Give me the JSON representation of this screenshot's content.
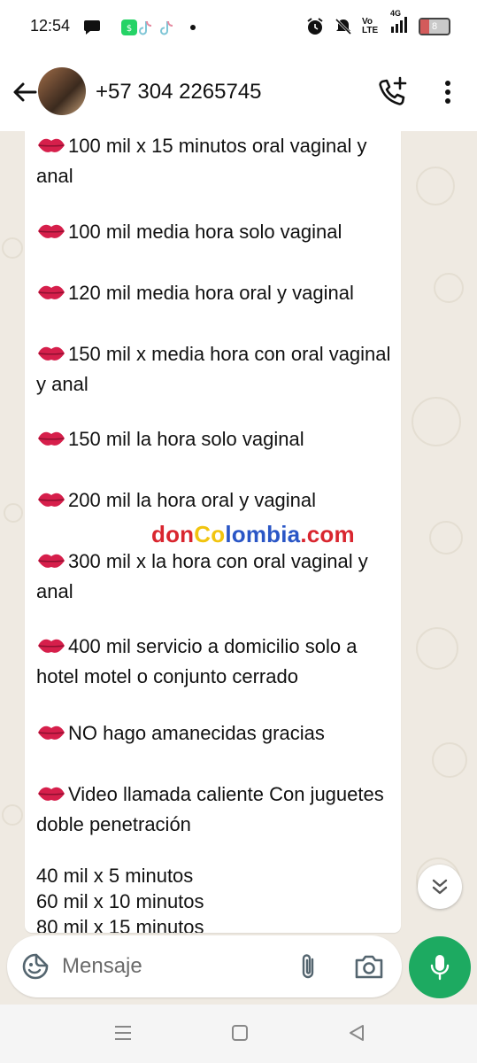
{
  "status_bar": {
    "time": "12:54",
    "battery_level": "8",
    "network": "4G",
    "volte": "Vo LTE",
    "left_icons": [
      "chat-bubble-icon",
      "whatsapp-icon",
      "tiktok-icon",
      "tiktok-icon",
      "dot-icon"
    ],
    "right_icons": [
      "alarm-icon",
      "mute-icon",
      "volte-icon",
      "signal-icon",
      "battery-icon"
    ]
  },
  "header": {
    "contact_name": "+57 304 2265745",
    "actions": [
      "back-arrow-icon",
      "add-call-icon",
      "more-vertical-icon"
    ]
  },
  "message": {
    "lines": [
      {
        "text": "100  mil x 15 minutos oral vaginal y anal",
        "icon": "kiss-lips-icon"
      },
      {
        "text": "100 mil media hora solo vaginal",
        "icon": "kiss-lips-icon"
      },
      {
        "text": "120 mil media hora  oral y vaginal",
        "icon": "kiss-lips-icon"
      },
      {
        "text": "150 mil x media hora con oral vaginal y anal",
        "icon": "kiss-lips-icon"
      },
      {
        "text": "150 mil  la hora solo vaginal",
        "icon": "kiss-lips-icon"
      },
      {
        "text": "200 mil la hora oral y vaginal",
        "icon": "kiss-lips-icon"
      },
      {
        "text": "300 mil x la hora con oral vaginal y anal",
        "icon": "kiss-lips-icon"
      },
      {
        "text": "400 mil servicio a domicilio solo a hotel motel o conjunto cerrado",
        "icon": "kiss-lips-icon"
      },
      {
        "text": "NO hago amanecidas gracias",
        "icon": "kiss-lips-icon"
      },
      {
        "text": "Video llamada caliente Con juguetes doble penetración",
        "icon": "kiss-lips-icon"
      }
    ],
    "plain_lines": [
      "40 mil x 5 minutos",
      "60 mil x 10 minutos",
      "80 mil x 15 minutos"
    ]
  },
  "watermark": {
    "part1": "don",
    "part2": "Co",
    "part3": "lombia",
    "part4": ".com",
    "colors": {
      "red": "#d9262f",
      "yellow": "#f1c40f",
      "blue": "#2a56c6"
    }
  },
  "input": {
    "placeholder": "Mensaje"
  },
  "colors": {
    "accent_green": "#1daa61",
    "wallpaper": "#efeae2",
    "bubble": "#ffffff"
  }
}
